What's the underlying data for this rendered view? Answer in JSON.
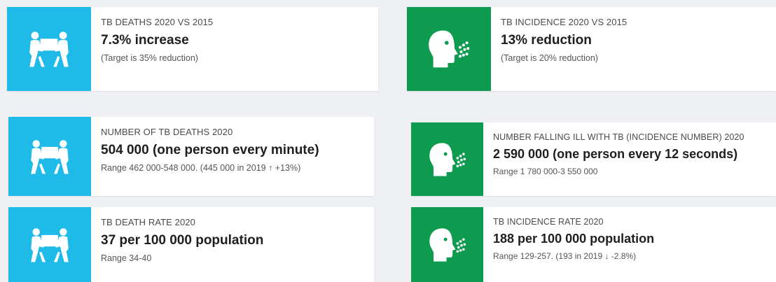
{
  "colors": {
    "deaths_accent": "#1ebbe9",
    "incidence_accent": "#0e9b50"
  },
  "icons": {
    "deaths": "people-carrying-coffin-icon",
    "incidence": "coughing-head-icon"
  },
  "cards": [
    {
      "label": "TB DEATHS 2020 VS 2015",
      "value": "7.3% increase",
      "sub": "(Target is 35% reduction)"
    },
    {
      "label": "TB INCIDENCE 2020 VS 2015",
      "value": "13% reduction",
      "sub": "(Target is 20% reduction)"
    },
    {
      "label": "NUMBER OF TB DEATHS 2020",
      "value": "504 000 (one person every minute)",
      "sub": "Range 462 000-548 000. (445 000 in 2019 ↑ +13%)"
    },
    {
      "label": "NUMBER FALLING ILL WITH TB (INCIDENCE NUMBER) 2020",
      "value": "2 590 000 (one person every 12 seconds)",
      "sub": "Range 1 780 000-3 550 000"
    },
    {
      "label": "TB DEATH RATE 2020",
      "value": "37 per 100 000 population",
      "sub": "Range 34-40"
    },
    {
      "label": "TB INCIDENCE RATE 2020",
      "value": "188 per 100 000 population",
      "sub": "Range 129-257. (193 in 2019 ↓ -2.8%)"
    }
  ]
}
